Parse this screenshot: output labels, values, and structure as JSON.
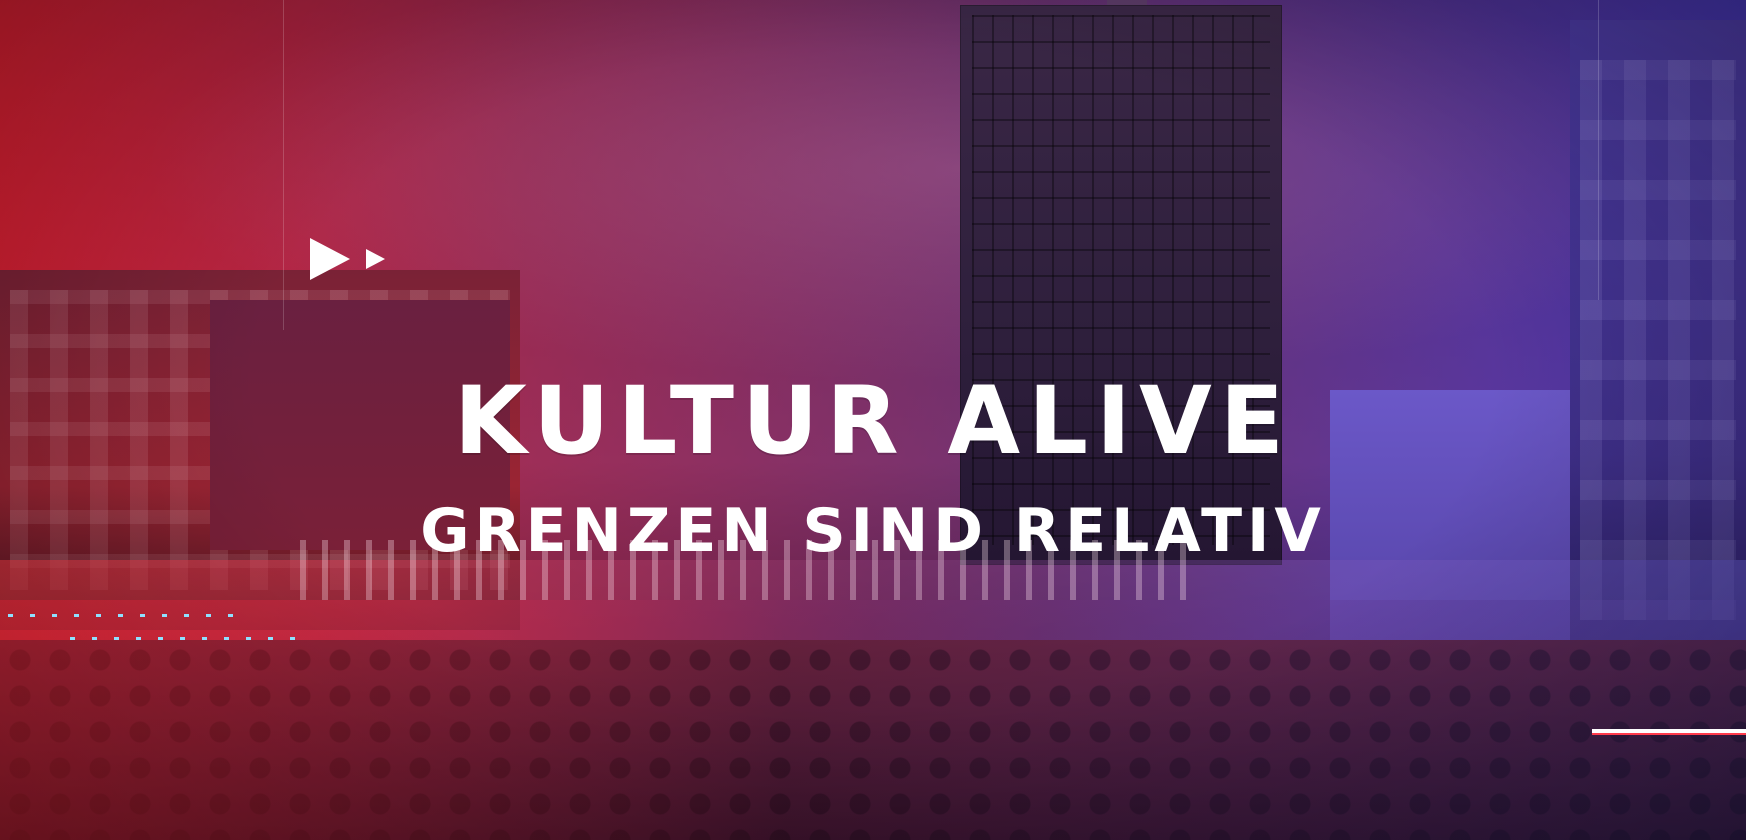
{
  "overlay": {
    "title": "KULTUR ALIVE",
    "subtitle": "GRENZEN SIND RELATIV"
  },
  "colors": {
    "text": "#ffffff",
    "tint_left": "#eb1e2d",
    "tint_right": "#463cd2",
    "dots": "#8fe0ff",
    "accent": "#ff3b4c"
  },
  "icons": [
    "play-icon",
    "play-icon-small"
  ]
}
